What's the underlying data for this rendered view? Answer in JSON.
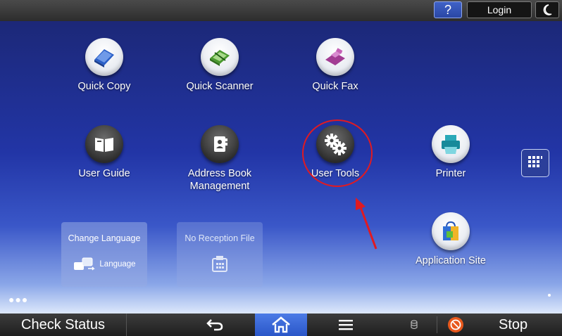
{
  "topbar": {
    "help_label": "?",
    "login_label": "Login"
  },
  "apps": [
    {
      "label": "Quick Copy"
    },
    {
      "label": "Quick Scanner"
    },
    {
      "label": "Quick Fax"
    },
    {
      "label": "User Guide"
    },
    {
      "label_line1": "Address Book",
      "label_line2": "Management"
    },
    {
      "label": "User Tools"
    },
    {
      "label": "Printer"
    },
    {
      "label": "Application Site"
    }
  ],
  "tiles": {
    "change_language": {
      "title": "Change Language",
      "sub": "Language"
    },
    "no_reception": {
      "title": "No Reception File"
    }
  },
  "bottombar": {
    "check_status": "Check Status",
    "stop": "Stop"
  },
  "colors": {
    "annotation": "#e01a22",
    "home_active": "#2f5fd4"
  }
}
